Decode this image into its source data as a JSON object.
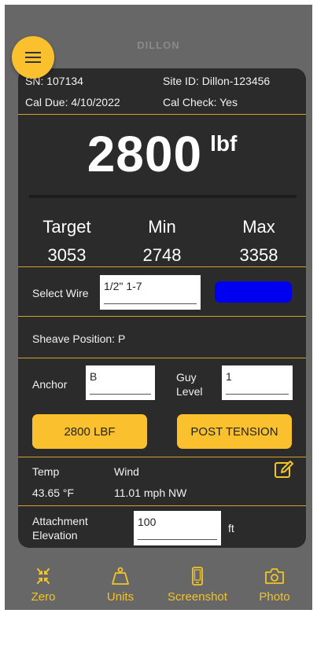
{
  "app": {
    "brand": "DILLON"
  },
  "info": {
    "sn": "SN: 107134",
    "site_id": "Site ID: Dillon-123456",
    "cal_due": "Cal Due:  4/10/2022",
    "cal_check": "Cal Check: Yes"
  },
  "reading": {
    "value": "2800",
    "unit": "lbf"
  },
  "targets": {
    "target_label": "Target",
    "target_value": "3053",
    "min_label": "Min",
    "min_value": "2748",
    "max_label": "Max",
    "max_value": "3358"
  },
  "wire": {
    "label": "Select Wire",
    "value": "1/2\" 1-7",
    "color": "#0000f0"
  },
  "sheave": {
    "text": "Sheave Position:  P"
  },
  "anchor": {
    "label": "Anchor",
    "value": "B"
  },
  "guy_level": {
    "label_line1": "Guy",
    "label_line2": "Level",
    "value": "1"
  },
  "buttons": {
    "lbf_label": "2800 LBF",
    "post_tension_label": "POST TENSION"
  },
  "weather": {
    "temp_label": "Temp",
    "temp_value": "43.65 °F",
    "wind_label": "Wind",
    "wind_value": "11.01 mph  NW",
    "edit_icon": "edit-icon"
  },
  "attachment": {
    "label_line1": "Attachment",
    "label_line2": "Elevation",
    "value": "100",
    "unit": "ft"
  },
  "nav": {
    "zero": "Zero",
    "units": "Units",
    "screenshot": "Screenshot",
    "photo": "Photo"
  },
  "colors": {
    "accent": "#fbc02d",
    "panel": "#2b2b2b",
    "background": "#676767"
  }
}
